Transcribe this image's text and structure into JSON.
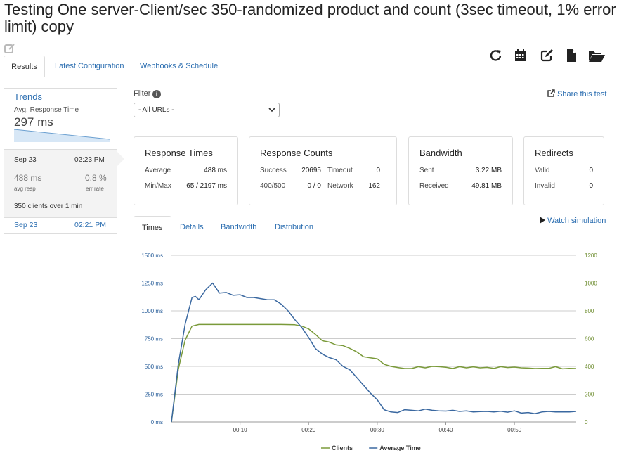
{
  "title": "Testing One server-Client/sec 350-randomized product and count (3sec timeout, 1% error limit) copy",
  "tabs": [
    "Results",
    "Latest Configuration",
    "Webhooks & Schedule"
  ],
  "toolbar": {
    "icons": [
      "refresh-icon",
      "calendar-icon",
      "edit-icon",
      "document-icon",
      "folder-open-icon"
    ]
  },
  "sidebar": {
    "trends_label": "Trends",
    "avg_label": "Avg. Response Time",
    "avg_value": "297 ms",
    "runs": [
      {
        "date": "Sep 23",
        "time": "02:23 PM",
        "avg_resp": "488 ms",
        "avg_resp_label": "avg resp",
        "err_rate": "0.8 %",
        "err_rate_label": "err rate",
        "clients_count": "350",
        "clients_text": "clients over",
        "duration": "1 min"
      },
      {
        "date": "Sep 23",
        "time": "02:21 PM"
      }
    ]
  },
  "filter": {
    "label": "Filter",
    "info": "i",
    "selected": "- All URLs -"
  },
  "share_label": "Share this test",
  "cards": {
    "response_times": {
      "title": "Response Times",
      "average_label": "Average",
      "average_value": "488 ms",
      "minmax_label": "Min/Max",
      "minmax_value": "65 / 2197 ms"
    },
    "response_counts": {
      "title": "Response Counts",
      "success_label": "Success",
      "success_value": "20695",
      "timeout_label": "Timeout",
      "timeout_value": "0",
      "http_label": "400/500",
      "http_value": "0 / 0",
      "network_label": "Network",
      "network_value": "162"
    },
    "bandwidth": {
      "title": "Bandwidth",
      "sent_label": "Sent",
      "sent_value": "3.22 MB",
      "received_label": "Received",
      "received_value": "49.81 MB"
    },
    "redirects": {
      "title": "Redirects",
      "valid_label": "Valid",
      "valid_value": "0",
      "invalid_label": "Invalid",
      "invalid_value": "0"
    }
  },
  "chart_tabs": [
    "Times",
    "Details",
    "Bandwidth",
    "Distribution"
  ],
  "watch_label": "Watch simulation",
  "colors": {
    "link": "#2a6db0",
    "clients": "#7a9a3a",
    "avg_time": "#3a68a0"
  },
  "chart_data": {
    "type": "line",
    "x_ticks": [
      "00:10",
      "00:20",
      "00:30",
      "00:40",
      "00:50"
    ],
    "x_range_seconds": [
      0,
      59
    ],
    "y_left": {
      "ticks": [
        "0 ms",
        "250 ms",
        "500 ms",
        "750 ms",
        "1000 ms",
        "1250 ms",
        "1500 ms"
      ],
      "range": [
        0,
        1500
      ]
    },
    "y_right": {
      "ticks": [
        "0",
        "200",
        "400",
        "600",
        "800",
        "1000",
        "1200"
      ],
      "range": [
        0,
        1200
      ]
    },
    "grid": true,
    "legend_position": "bottom",
    "series": [
      {
        "name": "Clients",
        "axis": "right",
        "x": [
          0,
          1,
          2,
          3,
          4,
          6,
          8,
          10,
          12,
          14,
          16,
          18,
          19,
          20,
          21,
          22,
          23,
          24,
          25,
          26,
          27,
          28,
          29,
          30,
          31,
          32,
          33,
          34,
          35,
          36,
          37,
          38,
          39,
          40,
          41,
          42,
          43,
          44,
          45,
          46,
          47,
          48,
          49,
          50,
          51,
          52,
          53,
          54,
          55,
          56,
          57,
          58,
          59
        ],
        "values": [
          0,
          380,
          590,
          690,
          702,
          702,
          702,
          702,
          702,
          702,
          702,
          700,
          690,
          670,
          630,
          585,
          575,
          555,
          550,
          530,
          505,
          470,
          462,
          455,
          415,
          400,
          392,
          385,
          385,
          398,
          390,
          400,
          398,
          394,
          385,
          398,
          390,
          397,
          390,
          393,
          386,
          398,
          392,
          395,
          390,
          388,
          385,
          386,
          386,
          398,
          383,
          386,
          385
        ]
      },
      {
        "name": "Average Time",
        "axis": "left",
        "x": [
          0,
          1,
          2,
          3,
          3.5,
          4,
          5,
          6,
          7,
          8,
          9,
          10,
          11,
          12,
          13,
          14,
          15,
          16,
          17,
          18,
          19,
          20,
          21,
          22,
          23,
          24,
          25,
          26,
          27,
          28,
          29,
          30,
          31,
          32,
          33,
          34,
          35,
          36,
          37,
          38,
          39,
          40,
          41,
          42,
          43,
          44,
          45,
          46,
          47,
          48,
          49,
          50,
          51,
          52,
          53,
          54,
          55,
          56,
          57,
          58,
          59
        ],
        "values": [
          0,
          520,
          880,
          1120,
          1130,
          1100,
          1190,
          1250,
          1160,
          1165,
          1140,
          1145,
          1120,
          1120,
          1110,
          1100,
          1100,
          1060,
          1000,
          920,
          850,
          760,
          660,
          610,
          580,
          560,
          500,
          470,
          400,
          330,
          260,
          200,
          110,
          90,
          85,
          110,
          105,
          100,
          115,
          105,
          100,
          98,
          105,
          95,
          100,
          90,
          93,
          95,
          90,
          96,
          88,
          100,
          80,
          85,
          75,
          90,
          95,
          90,
          90,
          90,
          95
        ]
      }
    ]
  }
}
